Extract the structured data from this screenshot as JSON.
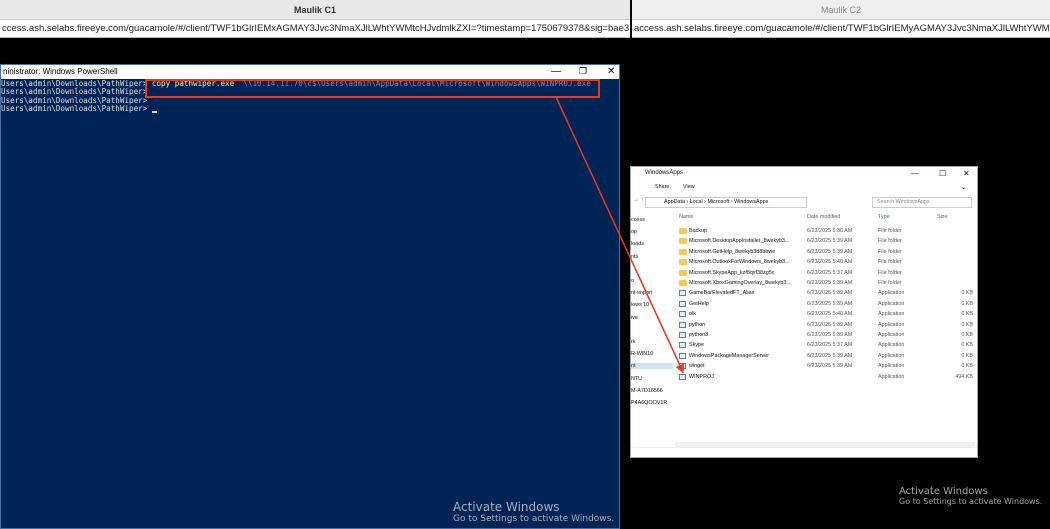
{
  "left_window": {
    "title": "Maulik C1",
    "url": "ccess.ash.selabs.fireeye.com/guacamole/#/client/TWF1bGlrIEMxAGMAY3Jvc3NmaXJlLWhtYWMtcHJvdmlkZXI=?timestamp=1750679378&sig=bae378456..."
  },
  "right_window": {
    "title": "Maulik C2",
    "url": "access.ash.selabs.fireeye.com/guacamole/#/client/TWF1bGlrIEMyAGMAY3Jvc3NmaXJlLWhtYWMtcHJvdmlkZXI=?timestamp="
  },
  "powershell": {
    "title": "ninistrator: Windows PowerShell",
    "prompt": "Users\\admin\\Downloads\\PathWiper>",
    "command": "copy pathwiper.exe",
    "command_path": "\\\\10.14.11.70\\c$\\Users\\admin\\AppData\\Local\\Microsoft\\WindowsApps\\WINPROJ.exe"
  },
  "explorer": {
    "title": "WindowsApps",
    "ribbon": [
      "Share",
      "View"
    ],
    "address": [
      "AppData",
      "Local",
      "Microsoft",
      "WindowsApps"
    ],
    "search_placeholder": "Search WindowsApps",
    "sidebar": [
      {
        "label": "ccess",
        "selected": false
      },
      {
        "label": "op",
        "selected": false
      },
      {
        "label": "loads",
        "selected": false
      },
      {
        "label": "nts",
        "selected": false
      },
      {
        "label": "",
        "selected": false
      },
      {
        "label": "o",
        "selected": false
      },
      {
        "label": "nt-import",
        "selected": false
      },
      {
        "label": "lows 10",
        "selected": false
      },
      {
        "label": "ive",
        "selected": false
      },
      {
        "label": "",
        "selected": true
      },
      {
        "label": "rk",
        "selected": false
      },
      {
        "label": "R-WIN10",
        "selected": false
      },
      {
        "label": "nt",
        "selected": true
      },
      {
        "label": "NTU",
        "selected": false
      },
      {
        "label": "M-A7D16566",
        "selected": false
      },
      {
        "label": "P4A6QOOV1R",
        "selected": false
      }
    ],
    "columns": {
      "name": "Name",
      "date": "Date modified",
      "type": "Type",
      "size": "Size"
    },
    "files": [
      {
        "name": "Backup",
        "date": "6/23/2025 5:36 AM",
        "type": "File folder",
        "size": "",
        "kind": "folder"
      },
      {
        "name": "Microsoft.DesktopAppInstaller_8wekyb3...",
        "date": "6/23/2025 5:39 AM",
        "type": "File folder",
        "size": "",
        "kind": "folder"
      },
      {
        "name": "Microsoft.GetHelp_8wekyb3d8bbwe",
        "date": "6/23/2025 5:39 AM",
        "type": "File folder",
        "size": "",
        "kind": "folder"
      },
      {
        "name": "Microsoft.OutlookForWindows_8wekyb3...",
        "date": "6/23/2025 5:40 AM",
        "type": "File folder",
        "size": "",
        "kind": "folder"
      },
      {
        "name": "Microsoft.SkypeApp_kzf8qxf38zg5c",
        "date": "6/23/2025 5:37 AM",
        "type": "File folder",
        "size": "",
        "kind": "folder"
      },
      {
        "name": "Microsoft.XboxGamingOverlay_8wekyb3...",
        "date": "6/23/2025 5:39 AM",
        "type": "File folder",
        "size": "",
        "kind": "folder"
      },
      {
        "name": "GameBarElevatedFT_Alias",
        "date": "6/23/2025 5:39 AM",
        "type": "Application",
        "size": "0 KB",
        "kind": "app"
      },
      {
        "name": "GetHelp",
        "date": "6/23/2025 5:39 AM",
        "type": "Application",
        "size": "0 KB",
        "kind": "app"
      },
      {
        "name": "olk",
        "date": "6/23/2025 5:40 AM",
        "type": "Application",
        "size": "0 KB",
        "kind": "app"
      },
      {
        "name": "python",
        "date": "6/23/2025 5:39 AM",
        "type": "Application",
        "size": "0 KB",
        "kind": "app"
      },
      {
        "name": "python3",
        "date": "6/23/2025 5:39 AM",
        "type": "Application",
        "size": "0 KB",
        "kind": "app"
      },
      {
        "name": "Skype",
        "date": "6/23/2025 5:37 AM",
        "type": "Application",
        "size": "0 KB",
        "kind": "app"
      },
      {
        "name": "WindowsPackageManagerServer",
        "date": "6/23/2025 5:39 AM",
        "type": "Application",
        "size": "0 KB",
        "kind": "app"
      },
      {
        "name": "winget",
        "date": "6/23/2025 5:39 AM",
        "type": "Application",
        "size": "0 KB",
        "kind": "app"
      },
      {
        "name": "WINPROJ",
        "date": "",
        "type": "Application",
        "size": "494 KB",
        "kind": "app"
      }
    ]
  },
  "watermark": {
    "heading": "Activate Windows",
    "sub": "Go to Settings to activate Windows."
  },
  "colors": {
    "powershell_bg": "#012456",
    "highlight_red": "#e33a22",
    "command_yellow": "#f2f29a"
  }
}
